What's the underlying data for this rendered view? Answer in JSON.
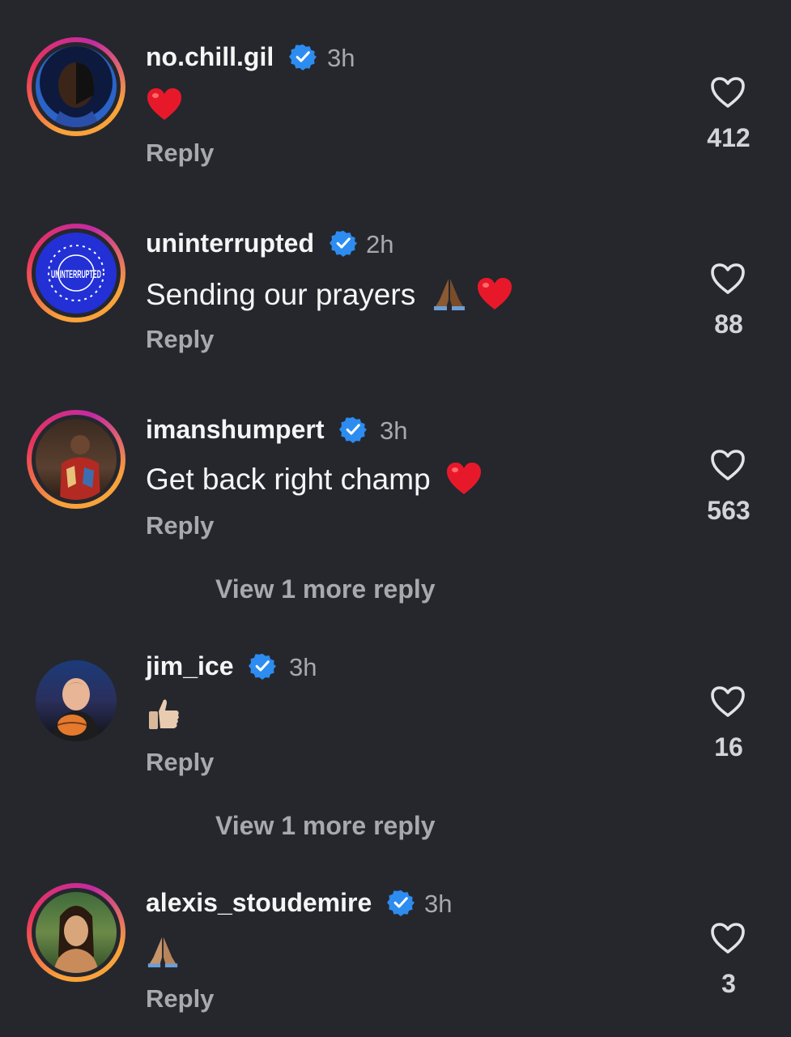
{
  "comments": [
    {
      "username": "no.chill.gil",
      "time": "3h",
      "text": "",
      "emoji": "heart",
      "reply": "Reply",
      "likes": "412"
    },
    {
      "username": "uninterrupted",
      "time": "2h",
      "text": "Sending our prayers",
      "emoji": "pray-heart",
      "reply": "Reply",
      "likes": "88",
      "avatar_text": "UNINTERRUPTED"
    },
    {
      "username": "imanshumpert",
      "time": "3h",
      "text": "Get back right champ",
      "emoji": "heart",
      "reply": "Reply",
      "likes": "563"
    },
    {
      "username": "jim_ice",
      "time": "3h",
      "text": "",
      "emoji": "thumbs-up",
      "reply": "Reply",
      "likes": "16"
    },
    {
      "username": "alexis_stoudemire",
      "time": "3h",
      "text": "",
      "emoji": "pray",
      "reply": "Reply",
      "likes": "3"
    }
  ],
  "view_more": [
    "View 1 more reply",
    "View 1 more reply"
  ],
  "colors": {
    "background": "#25272d",
    "verified": "#2d8cf0",
    "heart_emoji": "#e8182b",
    "muted_text": "#a8a9ad"
  }
}
